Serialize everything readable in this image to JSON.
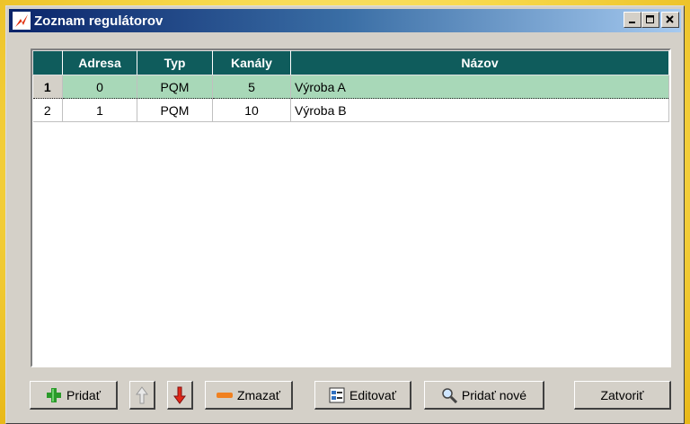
{
  "window": {
    "title": "Zoznam regulátorov",
    "icon": "lightning-icon",
    "controls": {
      "minimize": "_",
      "maximize": "□",
      "close": "×"
    }
  },
  "table": {
    "columns": [
      "",
      "Adresa",
      "Typ",
      "Kanály",
      "Názov"
    ],
    "rows": [
      {
        "index": "1",
        "adresa": "0",
        "typ": "PQM",
        "kanaly": "5",
        "nazov": "Výroba A",
        "selected": true
      },
      {
        "index": "2",
        "adresa": "1",
        "typ": "PQM",
        "kanaly": "10",
        "nazov": "Výroba B",
        "selected": false
      }
    ]
  },
  "buttons": {
    "add": "Pridať",
    "up_icon": "arrow-up-icon",
    "down_icon": "arrow-down-icon",
    "delete": "Zmazať",
    "edit": "Editovať",
    "add_new": "Pridať nové",
    "close": "Zatvoriť"
  },
  "colors": {
    "header_bg": "#0f5c5c",
    "selected_row": "#a8d8b8",
    "title_bar_start": "#0a246a",
    "title_bar_end": "#a6caf0"
  }
}
